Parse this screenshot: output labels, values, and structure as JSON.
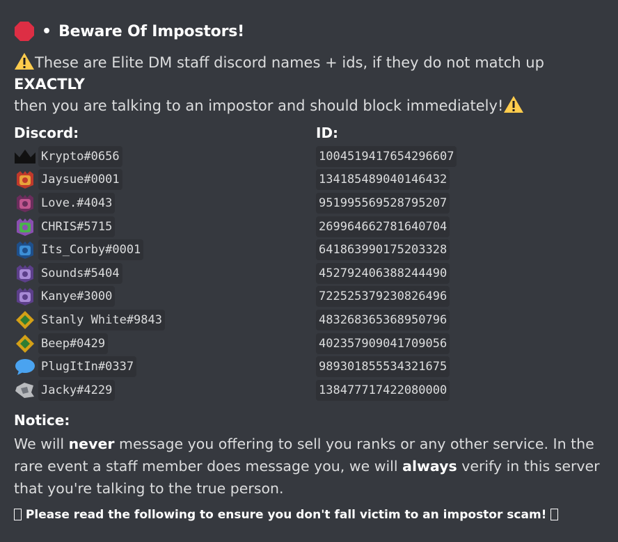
{
  "header": {
    "bullet": "•",
    "title": "Beware Of Impostors!",
    "icon": "stop-sign-icon"
  },
  "warning": {
    "text_before": "These are Elite DM staff discord names + ids, if they do not match up ",
    "emphasis": "EXACTLY",
    "text_after": "then you are talking to an impostor and should block immediately!",
    "icon": "warning-icon"
  },
  "columns": {
    "discord": "Discord:",
    "id": "ID:"
  },
  "staff": [
    {
      "name": "Krypto#0656",
      "id": "1004519417654296607",
      "icon": "crown-black-icon"
    },
    {
      "name": "Jaysue#0001",
      "id": "134185489040146432",
      "icon": "rank-orange-icon"
    },
    {
      "name": "Love.#4043",
      "id": "951995569528795207",
      "icon": "rank-pink-icon"
    },
    {
      "name": "CHRIS#5715",
      "id": "269964662781640704",
      "icon": "rank-green-icon"
    },
    {
      "name": "Its_Corby#0001",
      "id": "641863990175203328",
      "icon": "rank-blue-icon"
    },
    {
      "name": "Sounds#5404",
      "id": "452792406388244490",
      "icon": "rank-purple-icon"
    },
    {
      "name": "Kanye#3000",
      "id": "722525379230826496",
      "icon": "rank-purple-icon"
    },
    {
      "name": "Stanly White#9843",
      "id": "483268365368950796",
      "icon": "gem-gold-icon"
    },
    {
      "name": "Beep#0429",
      "id": "402357909041709056",
      "icon": "gem-gold-icon"
    },
    {
      "name": "PlugItIn#0337",
      "id": "989301855534321675",
      "icon": "chat-bubble-icon"
    },
    {
      "name": "Jacky#4229",
      "id": "138477717422080000",
      "icon": "rank-gray-icon"
    }
  ],
  "notice": {
    "title": "Notice:",
    "p1": "We will ",
    "b1": "never",
    "p2": " message you offering to sell you ranks or any other service. In the rare event a staff member does message you, we will ",
    "b2": "always",
    "p3": " verify in this server that you're talking to the true person."
  },
  "footer": {
    "text": " Please read the following to ensure you don't fall victim to an impostor scam! "
  },
  "colors": {
    "background": "#36393f",
    "code_bg": "#2f3136",
    "text": "#dcddde",
    "stop_red": "#dd2e44",
    "warning_yellow": "#ffcc4d"
  }
}
